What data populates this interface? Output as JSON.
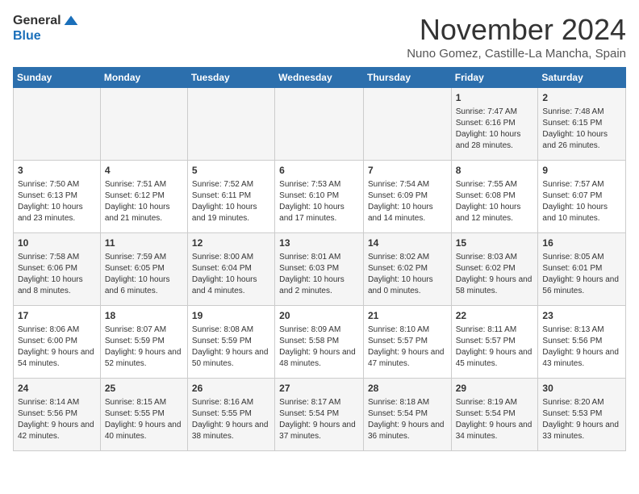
{
  "header": {
    "logo_general": "General",
    "logo_blue": "Blue",
    "month_title": "November 2024",
    "subtitle": "Nuno Gomez, Castille-La Mancha, Spain"
  },
  "days_of_week": [
    "Sunday",
    "Monday",
    "Tuesday",
    "Wednesday",
    "Thursday",
    "Friday",
    "Saturday"
  ],
  "weeks": [
    {
      "days": [
        {
          "num": "",
          "info": ""
        },
        {
          "num": "",
          "info": ""
        },
        {
          "num": "",
          "info": ""
        },
        {
          "num": "",
          "info": ""
        },
        {
          "num": "",
          "info": ""
        },
        {
          "num": "1",
          "info": "Sunrise: 7:47 AM\nSunset: 6:16 PM\nDaylight: 10 hours and 28 minutes."
        },
        {
          "num": "2",
          "info": "Sunrise: 7:48 AM\nSunset: 6:15 PM\nDaylight: 10 hours and 26 minutes."
        }
      ]
    },
    {
      "days": [
        {
          "num": "3",
          "info": "Sunrise: 7:50 AM\nSunset: 6:13 PM\nDaylight: 10 hours and 23 minutes."
        },
        {
          "num": "4",
          "info": "Sunrise: 7:51 AM\nSunset: 6:12 PM\nDaylight: 10 hours and 21 minutes."
        },
        {
          "num": "5",
          "info": "Sunrise: 7:52 AM\nSunset: 6:11 PM\nDaylight: 10 hours and 19 minutes."
        },
        {
          "num": "6",
          "info": "Sunrise: 7:53 AM\nSunset: 6:10 PM\nDaylight: 10 hours and 17 minutes."
        },
        {
          "num": "7",
          "info": "Sunrise: 7:54 AM\nSunset: 6:09 PM\nDaylight: 10 hours and 14 minutes."
        },
        {
          "num": "8",
          "info": "Sunrise: 7:55 AM\nSunset: 6:08 PM\nDaylight: 10 hours and 12 minutes."
        },
        {
          "num": "9",
          "info": "Sunrise: 7:57 AM\nSunset: 6:07 PM\nDaylight: 10 hours and 10 minutes."
        }
      ]
    },
    {
      "days": [
        {
          "num": "10",
          "info": "Sunrise: 7:58 AM\nSunset: 6:06 PM\nDaylight: 10 hours and 8 minutes."
        },
        {
          "num": "11",
          "info": "Sunrise: 7:59 AM\nSunset: 6:05 PM\nDaylight: 10 hours and 6 minutes."
        },
        {
          "num": "12",
          "info": "Sunrise: 8:00 AM\nSunset: 6:04 PM\nDaylight: 10 hours and 4 minutes."
        },
        {
          "num": "13",
          "info": "Sunrise: 8:01 AM\nSunset: 6:03 PM\nDaylight: 10 hours and 2 minutes."
        },
        {
          "num": "14",
          "info": "Sunrise: 8:02 AM\nSunset: 6:02 PM\nDaylight: 10 hours and 0 minutes."
        },
        {
          "num": "15",
          "info": "Sunrise: 8:03 AM\nSunset: 6:02 PM\nDaylight: 9 hours and 58 minutes."
        },
        {
          "num": "16",
          "info": "Sunrise: 8:05 AM\nSunset: 6:01 PM\nDaylight: 9 hours and 56 minutes."
        }
      ]
    },
    {
      "days": [
        {
          "num": "17",
          "info": "Sunrise: 8:06 AM\nSunset: 6:00 PM\nDaylight: 9 hours and 54 minutes."
        },
        {
          "num": "18",
          "info": "Sunrise: 8:07 AM\nSunset: 5:59 PM\nDaylight: 9 hours and 52 minutes."
        },
        {
          "num": "19",
          "info": "Sunrise: 8:08 AM\nSunset: 5:59 PM\nDaylight: 9 hours and 50 minutes."
        },
        {
          "num": "20",
          "info": "Sunrise: 8:09 AM\nSunset: 5:58 PM\nDaylight: 9 hours and 48 minutes."
        },
        {
          "num": "21",
          "info": "Sunrise: 8:10 AM\nSunset: 5:57 PM\nDaylight: 9 hours and 47 minutes."
        },
        {
          "num": "22",
          "info": "Sunrise: 8:11 AM\nSunset: 5:57 PM\nDaylight: 9 hours and 45 minutes."
        },
        {
          "num": "23",
          "info": "Sunrise: 8:13 AM\nSunset: 5:56 PM\nDaylight: 9 hours and 43 minutes."
        }
      ]
    },
    {
      "days": [
        {
          "num": "24",
          "info": "Sunrise: 8:14 AM\nSunset: 5:56 PM\nDaylight: 9 hours and 42 minutes."
        },
        {
          "num": "25",
          "info": "Sunrise: 8:15 AM\nSunset: 5:55 PM\nDaylight: 9 hours and 40 minutes."
        },
        {
          "num": "26",
          "info": "Sunrise: 8:16 AM\nSunset: 5:55 PM\nDaylight: 9 hours and 38 minutes."
        },
        {
          "num": "27",
          "info": "Sunrise: 8:17 AM\nSunset: 5:54 PM\nDaylight: 9 hours and 37 minutes."
        },
        {
          "num": "28",
          "info": "Sunrise: 8:18 AM\nSunset: 5:54 PM\nDaylight: 9 hours and 36 minutes."
        },
        {
          "num": "29",
          "info": "Sunrise: 8:19 AM\nSunset: 5:54 PM\nDaylight: 9 hours and 34 minutes."
        },
        {
          "num": "30",
          "info": "Sunrise: 8:20 AM\nSunset: 5:53 PM\nDaylight: 9 hours and 33 minutes."
        }
      ]
    }
  ]
}
